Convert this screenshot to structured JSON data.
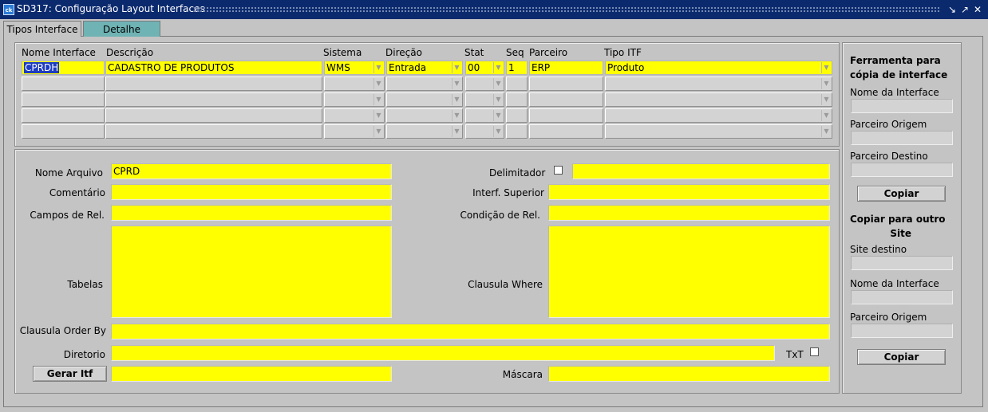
{
  "window": {
    "title": "SD317: Configuração Layout Interfaces",
    "app_icon_text": "ck",
    "controls": [
      "minimize-icon",
      "maximize-icon",
      "close-icon"
    ]
  },
  "tabs": [
    {
      "label": "Tipos Interface",
      "active": true
    },
    {
      "label": "Detalhe",
      "active": false
    }
  ],
  "grid": {
    "columns": [
      "Nome Interface",
      "Descrição",
      "Sistema",
      "Direção",
      "Stat",
      "Seq",
      "Parceiro",
      "Tipo ITF"
    ],
    "rows": [
      {
        "nome": "CPRDH",
        "descricao": "CADASTRO DE PRODUTOS",
        "sistema": "WMS",
        "direcao": "Entrada",
        "stat": "00",
        "seq": "1",
        "parceiro": "ERP",
        "tipo": "Produto"
      }
    ],
    "empty_rows": 4
  },
  "form": {
    "nome_arquivo": {
      "label": "Nome Arquivo",
      "value": "CPRD"
    },
    "comentario": {
      "label": "Comentário",
      "value": ""
    },
    "campos_rel": {
      "label": "Campos de Rel.",
      "value": ""
    },
    "tabelas": {
      "label": "Tabelas",
      "value": ""
    },
    "order_by": {
      "label": "Clausula Order By",
      "value": ""
    },
    "diretorio": {
      "label": "Diretorio",
      "value": ""
    },
    "gerar_itf": {
      "label": "Gerar Itf",
      "value": ""
    },
    "delimitador": {
      "label": "Delimitador",
      "checked": false,
      "value": ""
    },
    "interf_superior": {
      "label": "Interf. Superior",
      "value": ""
    },
    "condicao_rel": {
      "label": "Condição de Rel.",
      "value": ""
    },
    "clausula_where": {
      "label": "Clausula Where",
      "value": ""
    },
    "txt": {
      "label": "TxT",
      "checked": false
    },
    "mascara": {
      "label": "Máscara",
      "value": ""
    }
  },
  "side": {
    "copy_tool_title_line1": "Ferramenta para",
    "copy_tool_title_line2": "cópia de interface",
    "nome_interface_label": "Nome da Interface",
    "parceiro_origem_label": "Parceiro Origem",
    "parceiro_destino_label": "Parceiro Destino",
    "copiar_label": "Copiar",
    "copy_site_title_line1": "Copiar para outro",
    "copy_site_title_line2": "Site",
    "site_destino_label": "Site destino",
    "nome_interface2_label": "Nome da Interface",
    "parceiro_origem2_label": "Parceiro Origem",
    "copiar2_label": "Copiar"
  },
  "colors": {
    "field_yellow": "#ffff00",
    "title_bar": "#0b2a6e",
    "tab_inactive": "#6fb3b4",
    "selection": "#1e3cc0"
  }
}
